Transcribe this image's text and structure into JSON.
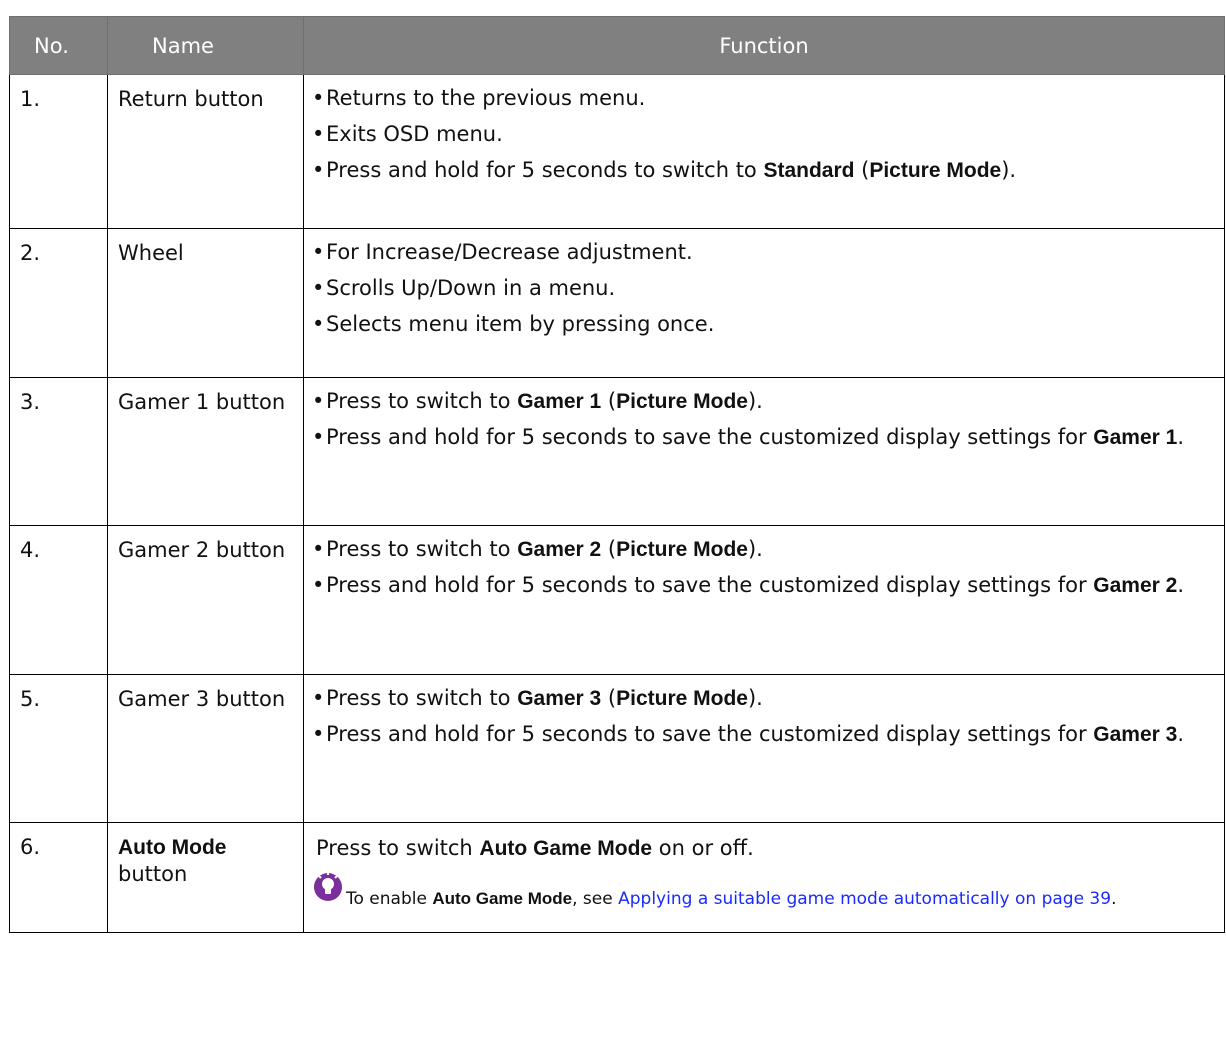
{
  "headers": {
    "no": "No.",
    "name": "Name",
    "function": "Function"
  },
  "rows": [
    {
      "no": "1.",
      "name": "Return button",
      "items": [
        {
          "pre": "Returns to the previous menu."
        },
        {
          "pre": "Exits OSD menu."
        },
        {
          "pre": "Press and hold for 5 seconds to switch to ",
          "b1": "Standard",
          "mid1": " (",
          "b2": "Picture Mode",
          "post": ")."
        }
      ]
    },
    {
      "no": "2.",
      "name": "Wheel",
      "items": [
        {
          "pre": "For Increase/Decrease adjustment."
        },
        {
          "pre": "Scrolls Up/Down in a menu."
        },
        {
          "pre": "Selects menu item by pressing once."
        }
      ]
    },
    {
      "no": "3.",
      "name": "Gamer 1 button",
      "items": [
        {
          "pre": "Press to switch to ",
          "b1": "Gamer 1",
          "mid1": " (",
          "b2": "Picture Mode",
          "post": ")."
        },
        {
          "pre": "Press and hold for 5 seconds to save the customized display settings for ",
          "b1": "Gamer 1",
          "post": "."
        }
      ]
    },
    {
      "no": "4.",
      "name": "Gamer 2 button",
      "items": [
        {
          "pre": "Press to switch to ",
          "b1": "Gamer 2",
          "mid1": " (",
          "b2": "Picture Mode",
          "post": ")."
        },
        {
          "pre": "Press and hold for 5 seconds to save the customized display settings for ",
          "b1": "Gamer 2",
          "post": "."
        }
      ]
    },
    {
      "no": "5.",
      "name": "Gamer 3 button",
      "items": [
        {
          "pre": "Press to switch to ",
          "b1": "Gamer 3",
          "mid1": " (",
          "b2": "Picture Mode",
          "post": ")."
        },
        {
          "pre": "Press and hold for 5 seconds to save the customized display settings for ",
          "b1": "Gamer 3",
          "post": "."
        }
      ]
    }
  ],
  "row6": {
    "no": "6.",
    "name_bold": "Auto Mode",
    "name_rest": "button",
    "text_pre": "Press to switch ",
    "text_bold": "Auto Game Mode",
    "text_post": " on or off.",
    "note_pre": "To enable ",
    "note_bold": "Auto Game Mode",
    "note_mid": ", see ",
    "note_link": "Applying a suitable game mode automatically on page 39",
    "note_post": "."
  },
  "bullet": "•",
  "colors": {
    "header_bg": "#808080",
    "link": "#1a2aff",
    "icon": "#7b2f9c"
  },
  "icons": [
    "lightbulb-note-icon"
  ]
}
